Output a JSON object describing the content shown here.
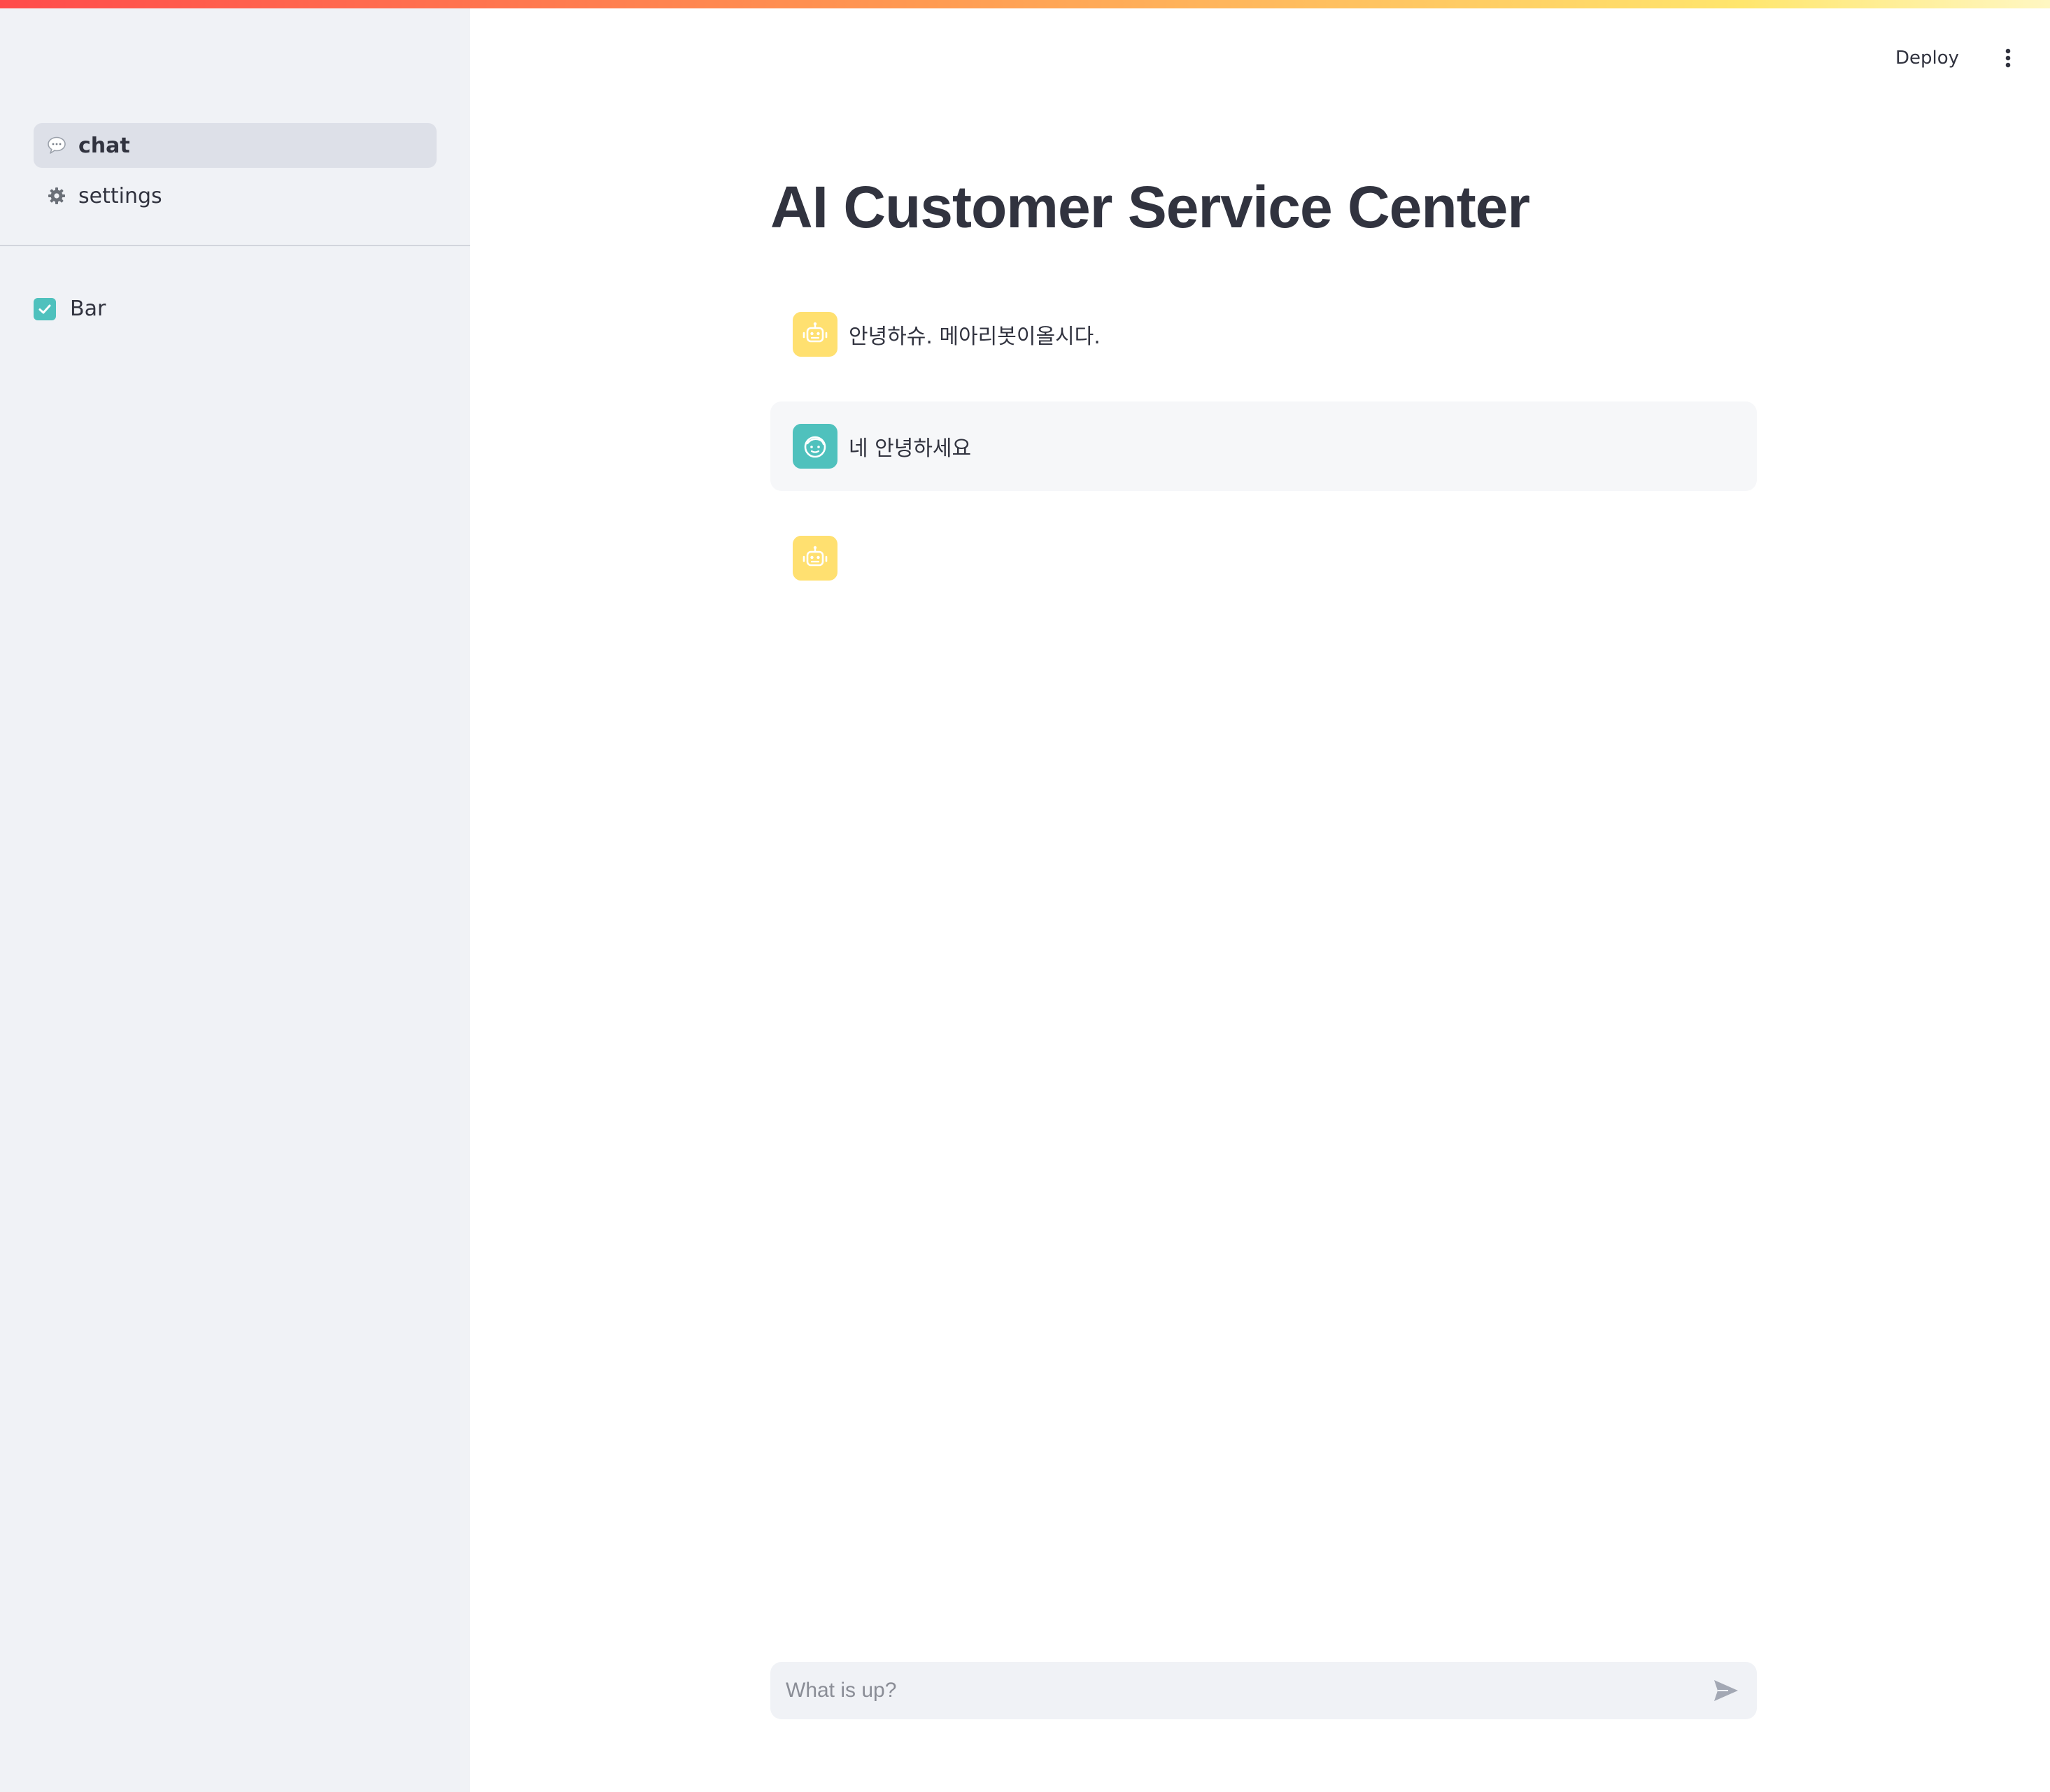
{
  "sidebar": {
    "nav": [
      {
        "label": "chat",
        "icon": "speech-bubble-icon",
        "active": true
      },
      {
        "label": "settings",
        "icon": "gear-icon",
        "active": false
      }
    ],
    "checkbox": {
      "label": "Bar",
      "checked": true
    }
  },
  "header": {
    "deploy_label": "Deploy",
    "menu_icon": "vertical-dots-icon"
  },
  "main": {
    "title": "AI Customer Service Center",
    "messages": [
      {
        "role": "assistant",
        "avatar_icon": "robot-face-icon",
        "text": "안녕하슈. 메아리봇이올시다."
      },
      {
        "role": "user",
        "avatar_icon": "user-face-icon",
        "text": "네 안녕하세요"
      },
      {
        "role": "assistant",
        "avatar_icon": "robot-face-icon",
        "text": ""
      }
    ]
  },
  "chat_input": {
    "placeholder": "What is up?",
    "send_icon": "send-arrow-icon"
  },
  "colors": {
    "sidebar_bg": "#f0f2f6",
    "accent_teal": "#4fc1bd",
    "bot_avatar": "#ffe070",
    "text": "#31333f"
  }
}
